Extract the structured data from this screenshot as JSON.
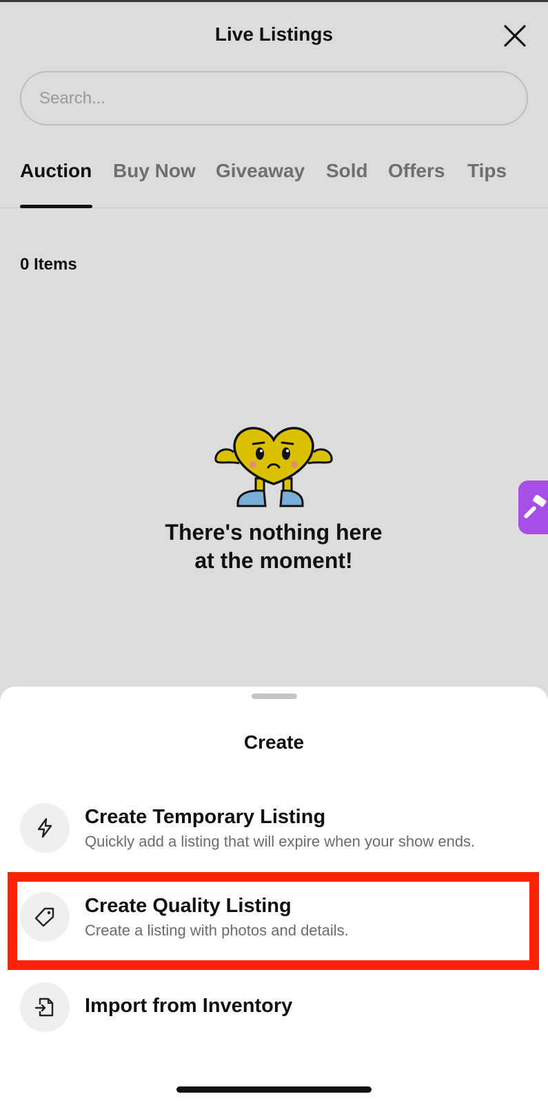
{
  "header": {
    "title": "Live Listings",
    "close_icon": "close-icon"
  },
  "search": {
    "placeholder": "Search...",
    "value": ""
  },
  "tabs": [
    {
      "label": "Auction",
      "active": true
    },
    {
      "label": "Buy Now",
      "active": false
    },
    {
      "label": "Giveaway",
      "active": false
    },
    {
      "label": "Sold",
      "active": false
    },
    {
      "label": "Offers",
      "active": false
    },
    {
      "label": "Tips",
      "active": false
    }
  ],
  "list": {
    "count_label": "0 Items"
  },
  "empty_state": {
    "mascot_icon": "heart-mascot-illustration",
    "line1": "There's nothing here",
    "line2": "at the moment!"
  },
  "floating_button": {
    "icon": "hammer-icon",
    "color": "#a64fe6"
  },
  "sheet": {
    "title": "Create",
    "options": [
      {
        "icon": "lightning-icon",
        "title": "Create Temporary Listing",
        "subtitle": "Quickly add a listing that will expire when your show ends."
      },
      {
        "icon": "tag-icon",
        "title": "Create Quality Listing",
        "subtitle": "Create a listing with photos and details.",
        "highlighted": true
      },
      {
        "icon": "import-file-icon",
        "title": "Import from Inventory",
        "subtitle": ""
      }
    ]
  },
  "colors": {
    "highlight": "#ff2200",
    "accent": "#a64fe6",
    "overlay_bg": "#dcdcdc"
  }
}
